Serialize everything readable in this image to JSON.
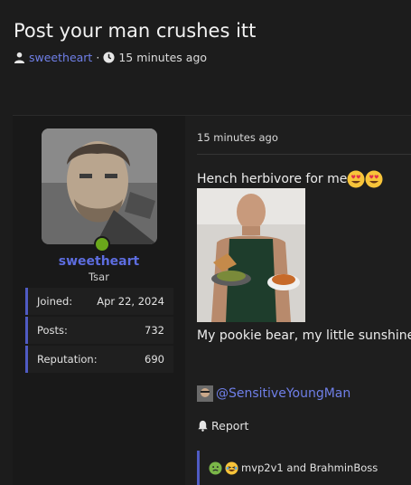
{
  "thread": {
    "title": "Post your man crushes itt",
    "author": "sweetheart",
    "separator": "·",
    "time": "15 minutes ago"
  },
  "user": {
    "name": "sweetheart",
    "title": "Tsar",
    "online": true,
    "stats": [
      {
        "label": "Joined:",
        "value": "Apr 22, 2024"
      },
      {
        "label": "Posts:",
        "value": "732"
      },
      {
        "label": "Reputation:",
        "value": "690"
      }
    ]
  },
  "post": {
    "time": "15 minutes ago",
    "text1": "Hench herbivore for me",
    "text2": "My pookie bear, my little sunshine",
    "mention": "@SensitiveYoungMan",
    "report": "Report",
    "reactions": "mvp2v1 and BrahminBoss"
  },
  "icons": {
    "user": "user-icon",
    "clock": "clock-icon",
    "bell": "bell-icon",
    "emoji": "heart-eyes-emoji",
    "reaction_emojis": [
      "nauseated-emoji",
      "laughing-emoji"
    ]
  },
  "colors": {
    "link": "#6f7fe8",
    "accent": "#4f5bc4",
    "online": "#6aa81b"
  }
}
